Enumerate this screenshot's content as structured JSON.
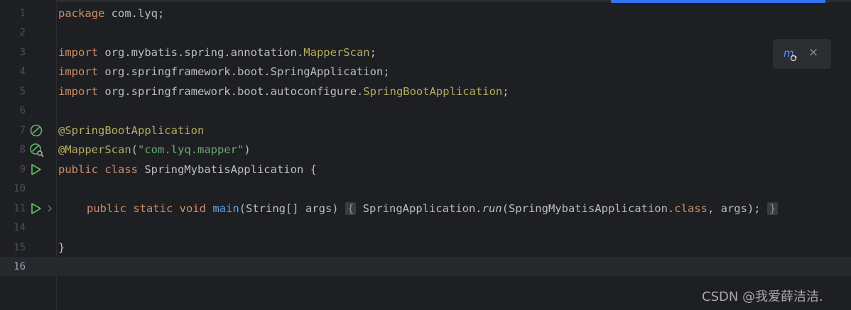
{
  "editor": {
    "line_numbers": [
      "1",
      "2",
      "3",
      "4",
      "5",
      "6",
      "7",
      "8",
      "9",
      "10",
      "11",
      "14",
      "15",
      "16"
    ],
    "active_line": "16",
    "lines": {
      "l1_kw": "package",
      "l1_rest": " com.lyq;",
      "l3_kw": "import",
      "l3_rest": " org.mybatis.spring.annotation.",
      "l3_cls": "MapperScan",
      "l3_end": ";",
      "l4_kw": "import",
      "l4_rest": " org.springframework.boot.SpringApplication;",
      "l5_kw": "import",
      "l5_rest": " org.springframework.boot.autoconfigure.",
      "l5_cls": "SpringBootApplication",
      "l5_end": ";",
      "l7_ann": "@SpringBootApplication",
      "l8_ann": "@MapperScan",
      "l8_open": "(",
      "l8_str": "\"com.lyq.mapper\"",
      "l8_close": ")",
      "l9_kw": "public class",
      "l9_rest": " SpringMybatisApplication {",
      "l11_kw": "public static void",
      "l11_fn": "main",
      "l11_params": "(String[] args)",
      "l11_brace_open": "{",
      "l11_call1": " SpringApplication.",
      "l11_run": "run",
      "l11_call2": "(SpringMybatisApplication.",
      "l11_class_kw": "class",
      "l11_call3": ", args);",
      "l11_brace_close": "}",
      "l15": "}"
    }
  },
  "inlay_popup": {
    "close_symbol": "×"
  },
  "watermark": "CSDN @我爱薛洁洁."
}
